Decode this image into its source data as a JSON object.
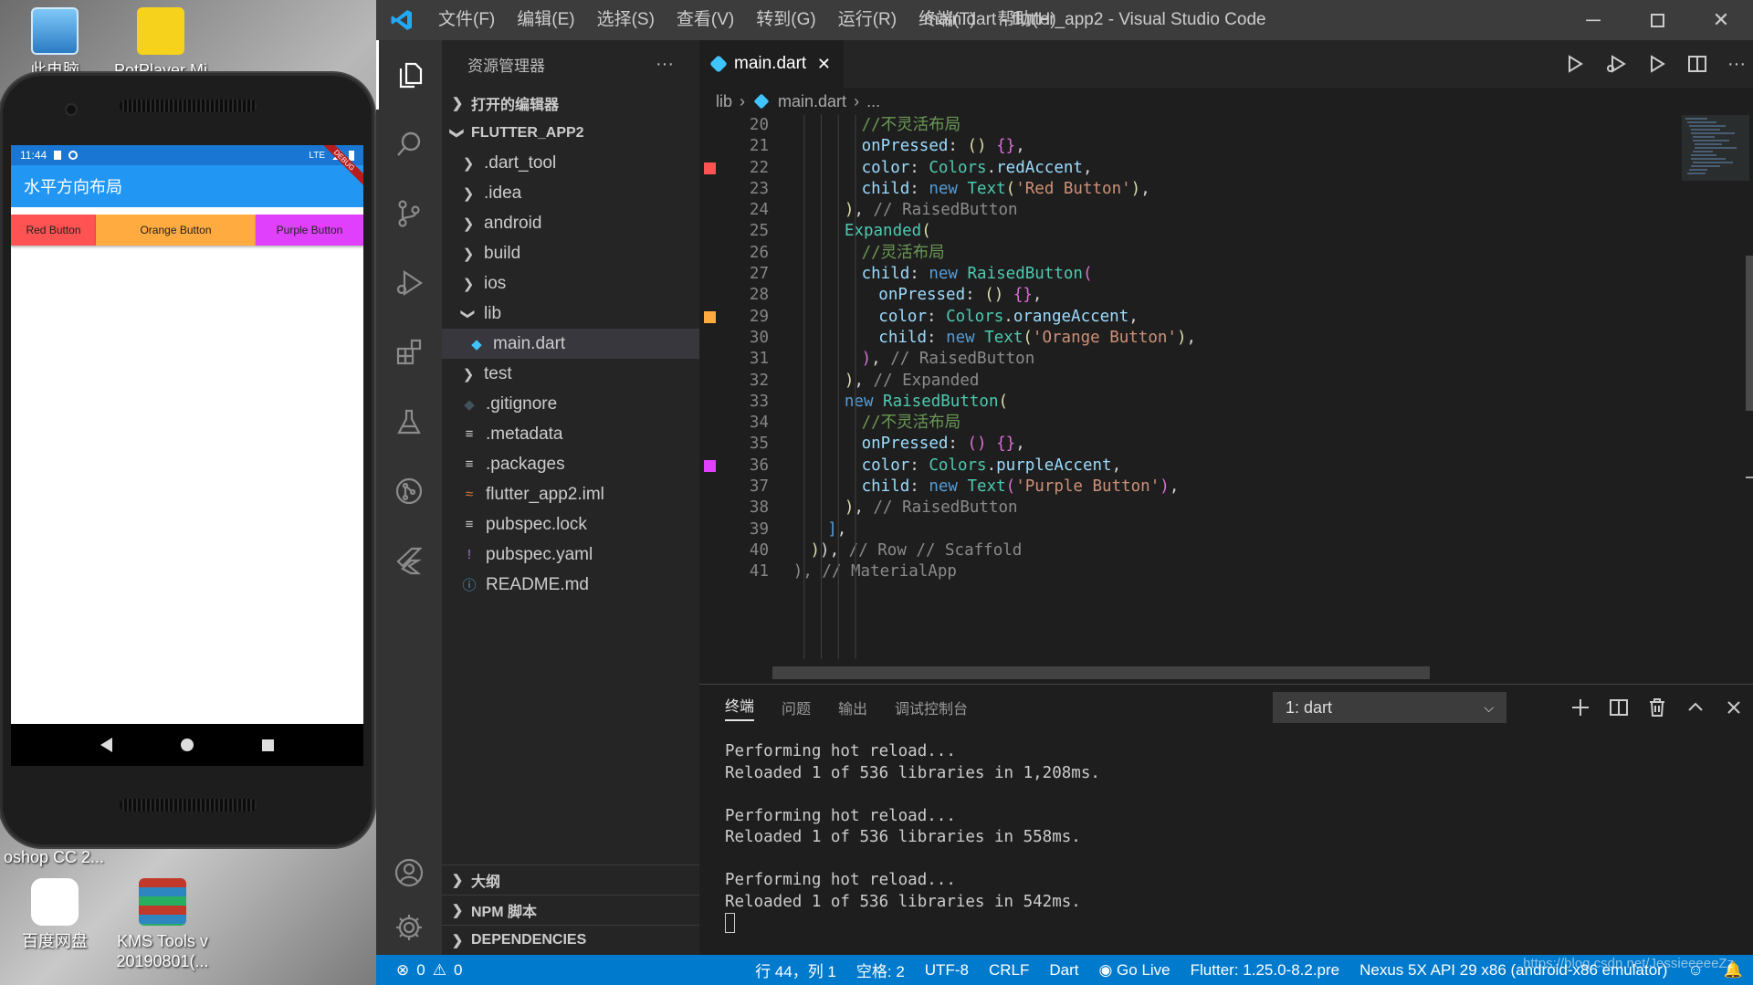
{
  "desktop": {
    "icons": [
      {
        "label": "此电脑"
      },
      {
        "label": "PotPlayer Mi"
      },
      {
        "label": "oshop CC 2..."
      },
      {
        "label": "百度网盘"
      },
      {
        "label": "KMS Tools v 20190801(..."
      }
    ]
  },
  "phone": {
    "status_time": "11:44",
    "status_right": "LTE",
    "debug_ribbon": "DEBUG",
    "app_title": "水平方向布局",
    "buttons": [
      {
        "label": "Red Button",
        "color": "#ff5252"
      },
      {
        "label": "Orange Button",
        "color": "#ffab40"
      },
      {
        "label": "Purple Button",
        "color": "#e040fb"
      }
    ]
  },
  "vscode": {
    "menu": [
      "文件(F)",
      "编辑(E)",
      "选择(S)",
      "查看(V)",
      "转到(G)",
      "运行(R)",
      "终端(T)",
      "帮助(H)"
    ],
    "window_title": "main.dart - flutter_app2 - Visual Studio Code",
    "sidebar": {
      "title": "资源管理器",
      "more": "···",
      "open_editors": "打开的编辑器",
      "project": "FLUTTER_APP2",
      "tree": [
        {
          "label": ".dart_tool",
          "type": "folder"
        },
        {
          "label": ".idea",
          "type": "folder"
        },
        {
          "label": "android",
          "type": "folder"
        },
        {
          "label": "build",
          "type": "folder"
        },
        {
          "label": "ios",
          "type": "folder"
        },
        {
          "label": "lib",
          "type": "folder-open"
        },
        {
          "label": "main.dart",
          "type": "dart"
        },
        {
          "label": "test",
          "type": "folder"
        },
        {
          "label": ".gitignore",
          "type": "git"
        },
        {
          "label": ".metadata",
          "type": "text"
        },
        {
          "label": ".packages",
          "type": "text"
        },
        {
          "label": "flutter_app2.iml",
          "type": "rss"
        },
        {
          "label": "pubspec.lock",
          "type": "text"
        },
        {
          "label": "pubspec.yaml",
          "type": "yaml"
        },
        {
          "label": "README.md",
          "type": "info"
        }
      ],
      "outline": "大纲",
      "npm": "NPM 脚本",
      "dependencies": "DEPENDENCIES"
    },
    "tab": {
      "label": "main.dart"
    },
    "breadcrumb": [
      "lib",
      "main.dart",
      "..."
    ],
    "code_lines": [
      {
        "n": "20",
        "mark": "",
        "indent": 8,
        "tokens": [
          [
            "com",
            "//不灵活布局"
          ]
        ]
      },
      {
        "n": "21",
        "mark": "",
        "indent": 8,
        "tokens": [
          [
            "prop",
            "onPressed"
          ],
          [
            "pun",
            ": "
          ],
          [
            "fn",
            "()"
          ],
          [
            "pun",
            " "
          ],
          [
            "brk",
            "{}"
          ],
          [
            "pun",
            ","
          ]
        ]
      },
      {
        "n": "22",
        "mark": "#ff5252",
        "indent": 8,
        "tokens": [
          [
            "prop",
            "color"
          ],
          [
            "pun",
            ": "
          ],
          [
            "cls",
            "Colors"
          ],
          [
            "pun",
            "."
          ],
          [
            "prop",
            "redAccent"
          ],
          [
            "pun",
            ","
          ]
        ]
      },
      {
        "n": "23",
        "mark": "",
        "indent": 8,
        "tokens": [
          [
            "prop",
            "child"
          ],
          [
            "pun",
            ": "
          ],
          [
            "key",
            "new "
          ],
          [
            "cls",
            "Text"
          ],
          [
            "fn",
            "("
          ],
          [
            "str",
            "'Red Button'"
          ],
          [
            "fn",
            ")"
          ],
          [
            "pun",
            ","
          ]
        ]
      },
      {
        "n": "24",
        "mark": "",
        "indent": 7,
        "tokens": [
          [
            "fn",
            ")"
          ],
          [
            "pun",
            ", "
          ],
          [
            "hint",
            "// RaisedButton"
          ]
        ]
      },
      {
        "n": "25",
        "mark": "",
        "indent": 7,
        "tokens": [
          [
            "cls",
            "Expanded"
          ],
          [
            "fn",
            "("
          ]
        ]
      },
      {
        "n": "26",
        "mark": "",
        "indent": 8,
        "tokens": [
          [
            "com",
            "//灵活布局"
          ]
        ]
      },
      {
        "n": "27",
        "mark": "",
        "indent": 8,
        "tokens": [
          [
            "prop",
            "child"
          ],
          [
            "pun",
            ": "
          ],
          [
            "key",
            "new "
          ],
          [
            "cls",
            "RaisedButton"
          ],
          [
            "brk",
            "("
          ]
        ]
      },
      {
        "n": "28",
        "mark": "",
        "indent": 9,
        "tokens": [
          [
            "prop",
            "onPressed"
          ],
          [
            "pun",
            ": "
          ],
          [
            "fn",
            "()"
          ],
          [
            "pun",
            " "
          ],
          [
            "brk",
            "{}"
          ],
          [
            "pun",
            ","
          ]
        ]
      },
      {
        "n": "29",
        "mark": "#ffab40",
        "indent": 9,
        "tokens": [
          [
            "prop",
            "color"
          ],
          [
            "pun",
            ": "
          ],
          [
            "cls",
            "Colors"
          ],
          [
            "pun",
            "."
          ],
          [
            "prop",
            "orangeAccent"
          ],
          [
            "pun",
            ","
          ]
        ]
      },
      {
        "n": "30",
        "mark": "",
        "indent": 9,
        "tokens": [
          [
            "prop",
            "child"
          ],
          [
            "pun",
            ": "
          ],
          [
            "key",
            "new "
          ],
          [
            "cls",
            "Text"
          ],
          [
            "fn",
            "("
          ],
          [
            "str",
            "'Orange Button'"
          ],
          [
            "fn",
            ")"
          ],
          [
            "pun",
            ","
          ]
        ]
      },
      {
        "n": "31",
        "mark": "",
        "indent": 8,
        "tokens": [
          [
            "brk",
            ")"
          ],
          [
            "pun",
            ", "
          ],
          [
            "hint",
            "// RaisedButton"
          ]
        ]
      },
      {
        "n": "32",
        "mark": "",
        "indent": 7,
        "tokens": [
          [
            "fn",
            ")"
          ],
          [
            "pun",
            ", "
          ],
          [
            "hint",
            "// Expanded"
          ]
        ]
      },
      {
        "n": "33",
        "mark": "",
        "indent": 7,
        "tokens": [
          [
            "key",
            "new "
          ],
          [
            "cls",
            "RaisedButton"
          ],
          [
            "fn",
            "("
          ]
        ]
      },
      {
        "n": "34",
        "mark": "",
        "indent": 8,
        "tokens": [
          [
            "com",
            "//不灵活布局"
          ]
        ]
      },
      {
        "n": "35",
        "mark": "",
        "indent": 8,
        "tokens": [
          [
            "prop",
            "onPressed"
          ],
          [
            "pun",
            ": "
          ],
          [
            "brk",
            "()"
          ],
          [
            "pun",
            " "
          ],
          [
            "brk",
            "{}"
          ],
          [
            "pun",
            ","
          ]
        ]
      },
      {
        "n": "36",
        "mark": "#e040fb",
        "indent": 8,
        "tokens": [
          [
            "prop",
            "color"
          ],
          [
            "pun",
            ": "
          ],
          [
            "cls",
            "Colors"
          ],
          [
            "pun",
            "."
          ],
          [
            "prop",
            "purpleAccent"
          ],
          [
            "pun",
            ","
          ]
        ]
      },
      {
        "n": "37",
        "mark": "",
        "indent": 8,
        "tokens": [
          [
            "prop",
            "child"
          ],
          [
            "pun",
            ": "
          ],
          [
            "key",
            "new "
          ],
          [
            "cls",
            "Text"
          ],
          [
            "brk",
            "("
          ],
          [
            "str",
            "'Purple Button'"
          ],
          [
            "brk",
            ")"
          ],
          [
            "pun",
            ","
          ]
        ]
      },
      {
        "n": "38",
        "mark": "",
        "indent": 7,
        "tokens": [
          [
            "fn",
            ")"
          ],
          [
            "pun",
            ", "
          ],
          [
            "hint",
            "// RaisedButton"
          ]
        ]
      },
      {
        "n": "39",
        "mark": "",
        "indent": 6,
        "tokens": [
          [
            "key",
            "]"
          ],
          [
            "pun",
            ","
          ]
        ]
      },
      {
        "n": "40",
        "mark": "",
        "indent": 5,
        "tokens": [
          [
            "fn",
            ")"
          ],
          [
            "pun",
            "), "
          ],
          [
            "hint",
            "// Row // Scaffold"
          ]
        ]
      },
      {
        "n": "41",
        "mark": "",
        "indent": 4,
        "tokens": [
          [
            "hint",
            "), // MaterialApp"
          ]
        ]
      }
    ],
    "panel": {
      "tabs": [
        "终端",
        "问题",
        "输出",
        "调试控制台"
      ],
      "terminal_select": "1: dart",
      "terminal_lines": [
        "Performing hot reload...",
        "Reloaded 1 of 536 libraries in 1,208ms.",
        "",
        "Performing hot reload...",
        "Reloaded 1 of 536 libraries in 558ms.",
        "",
        "Performing hot reload...",
        "Reloaded 1 of 536 libraries in 542ms."
      ]
    },
    "statusbar": {
      "errors": "0",
      "warnings": "0",
      "position": "行 44，列 1",
      "spaces": "空格: 2",
      "encoding": "UTF-8",
      "eol": "CRLF",
      "language": "Dart",
      "golive": "Go Live",
      "flutter": "Flutter: 1.25.0-8.2.pre",
      "device": "Nexus 5X API 29 x86 (android-x86 emulator)",
      "watermark": "https://blog.csdn.net/JessieeeeeZz"
    }
  }
}
